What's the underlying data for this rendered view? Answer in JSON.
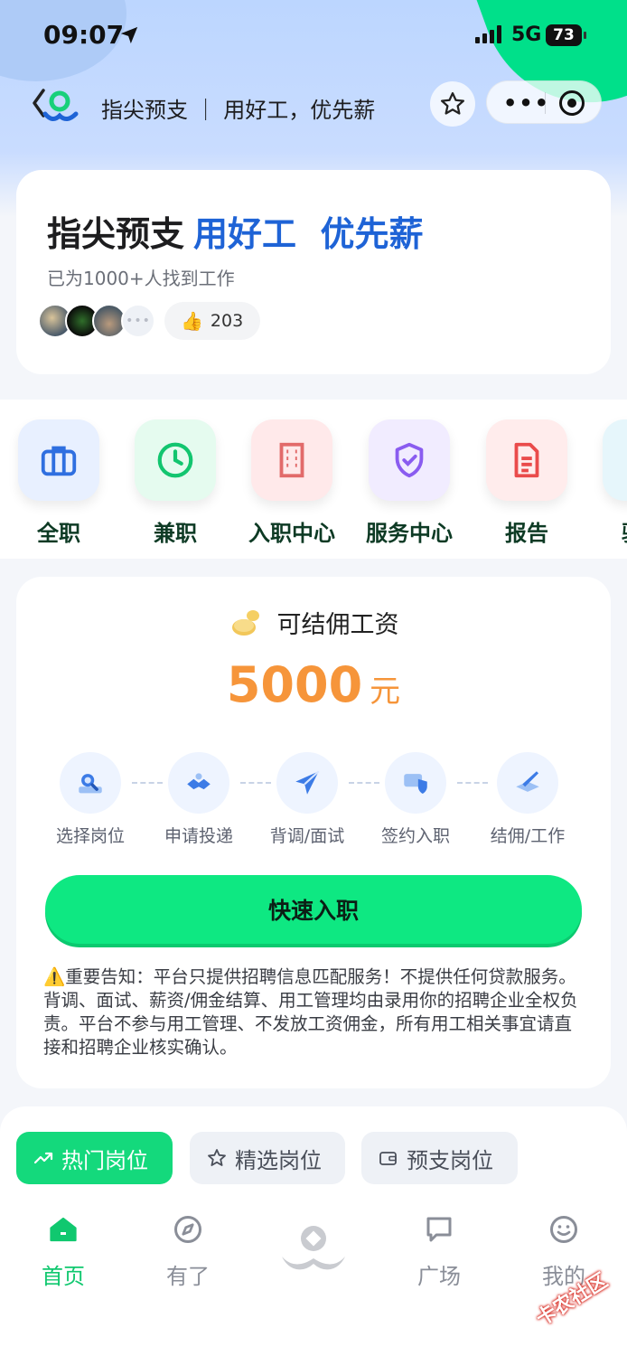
{
  "status_bar": {
    "time": "09:07",
    "network": "5G",
    "battery": "73"
  },
  "nav": {
    "title": "指尖预支 ｜ 用好工，优先薪"
  },
  "hero": {
    "title_main": "指尖预支",
    "title_highlight": "用好工  优先薪",
    "subtitle": "已为1000+人找到工作",
    "likes": "203"
  },
  "categories": [
    {
      "label": "全职",
      "icon": "briefcase-icon",
      "bg": "#e8f0ff",
      "color": "#2f6fe0"
    },
    {
      "label": "兼职",
      "icon": "clock-icon",
      "bg": "#e5fbef",
      "color": "#12c56f"
    },
    {
      "label": "入职中心",
      "icon": "building-icon",
      "bg": "#ffe9ea",
      "color": "#e26a6a"
    },
    {
      "label": "服务中心",
      "icon": "shield-check-icon",
      "bg": "#f1ecff",
      "color": "#8a5cf0"
    },
    {
      "label": "报告",
      "icon": "document-icon",
      "bg": "#ffecec",
      "color": "#ea4b4b"
    },
    {
      "label": "骑手",
      "icon": "rider-icon",
      "bg": "#e6f6fb",
      "color": "#2ba7c9"
    }
  ],
  "salary": {
    "label": "可结佣工资",
    "amount": "5000",
    "unit": "元",
    "steps": [
      "选择岗位",
      "申请投递",
      "背调/面试",
      "签约入职",
      "结佣/工作"
    ],
    "cta": "快速入职",
    "notice_icon": "⚠️",
    "notice": "重要告知：平台只提供招聘信息匹配服务！不提供任何贷款服务。背调、面试、薪资/佣金结算、用工管理均由录用你的招聘企业全权负责。平台不参与用工管理、不发放工资佣金，所有用工相关事宜请直接和招聘企业核实确认。"
  },
  "tabs": [
    "热门岗位",
    "精选岗位",
    "预支岗位"
  ],
  "bottom_nav": [
    "首页",
    "有了",
    "广场",
    "我的"
  ],
  "watermark": "卡农社区"
}
